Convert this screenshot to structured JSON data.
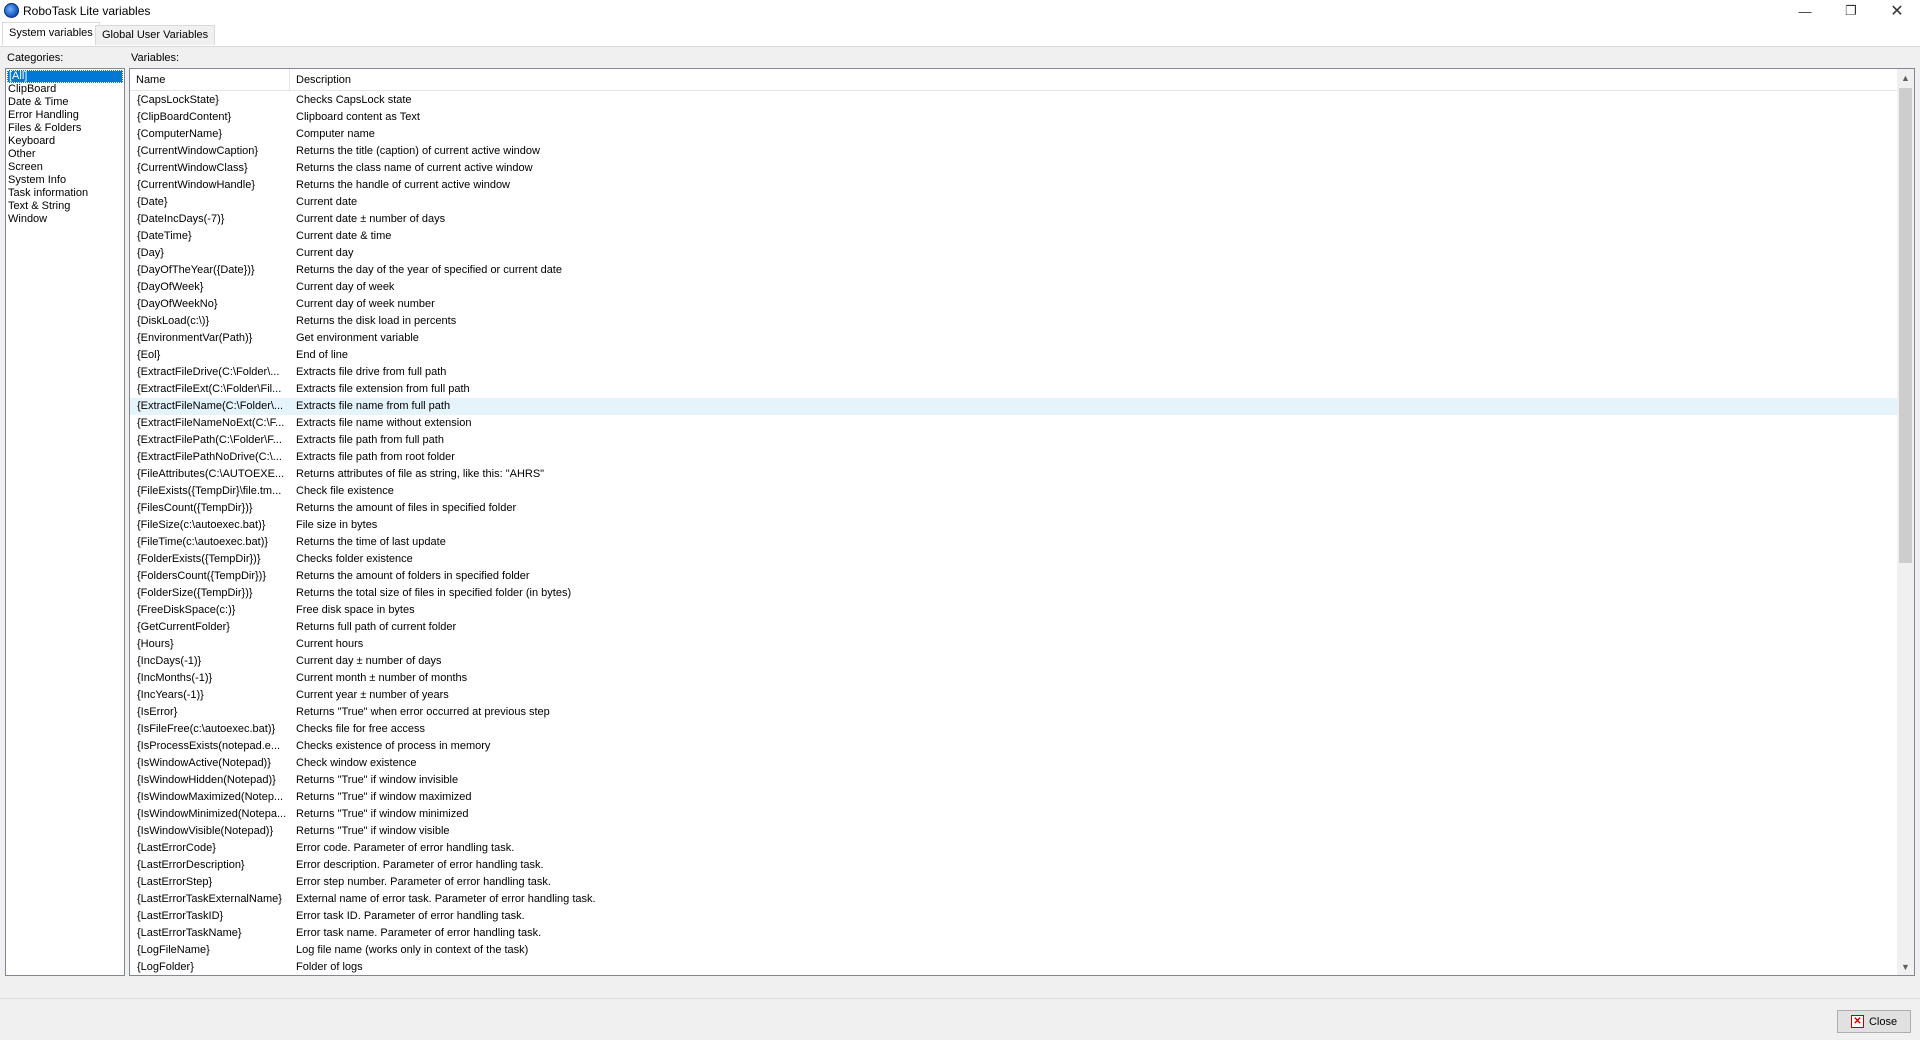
{
  "window": {
    "title": "RoboTask Lite variables",
    "minimize_glyph": "—",
    "maximize_glyph": "❐",
    "close_glyph": "✕"
  },
  "tabs": [
    {
      "label": "System variables",
      "active": true
    },
    {
      "label": "Global User Variables",
      "active": false
    }
  ],
  "categories_label": "Categories:",
  "variables_label": "Variables:",
  "categories": [
    "[All]",
    "ClipBoard",
    "Date & Time",
    "Error Handling",
    "Files & Folders",
    "Keyboard",
    "Other",
    "Screen",
    "System Info",
    "Task information",
    "Text & String",
    "Window"
  ],
  "selected_category": "[All]",
  "columns": {
    "name": "Name",
    "description": "Description"
  },
  "variables": [
    {
      "name": "{CapsLockState}",
      "desc": "Checks CapsLock state"
    },
    {
      "name": "{ClipBoardContent}",
      "desc": "Clipboard content as Text"
    },
    {
      "name": "{ComputerName}",
      "desc": "Computer name"
    },
    {
      "name": "{CurrentWindowCaption}",
      "desc": "Returns the title (caption) of current active window"
    },
    {
      "name": "{CurrentWindowClass}",
      "desc": "Returns the class name of current active window"
    },
    {
      "name": "{CurrentWindowHandle}",
      "desc": "Returns the handle of current active window"
    },
    {
      "name": "{Date}",
      "desc": "Current date"
    },
    {
      "name": "{DateIncDays(-7)}",
      "desc": "Current date ± number of days"
    },
    {
      "name": "{DateTime}",
      "desc": "Current date & time"
    },
    {
      "name": "{Day}",
      "desc": "Current day"
    },
    {
      "name": "{DayOfTheYear({Date})}",
      "desc": "Returns the day of the year of specified or current date"
    },
    {
      "name": "{DayOfWeek}",
      "desc": "Current day of week"
    },
    {
      "name": "{DayOfWeekNo}",
      "desc": "Current day of week number"
    },
    {
      "name": "{DiskLoad(c:\\)}",
      "desc": "Returns the disk load in percents"
    },
    {
      "name": "{EnvironmentVar(Path)}",
      "desc": "Get environment variable"
    },
    {
      "name": "{Eol}",
      "desc": "End of line"
    },
    {
      "name": "{ExtractFileDrive(C:\\Folder\\...",
      "desc": "Extracts file drive from full path"
    },
    {
      "name": "{ExtractFileExt(C:\\Folder\\Fil...",
      "desc": "Extracts file extension from full path"
    },
    {
      "name": "{ExtractFileName(C:\\Folder\\...",
      "desc": "Extracts file name from full path",
      "highlight": true
    },
    {
      "name": "{ExtractFileNameNoExt(C:\\F...",
      "desc": "Extracts file name without extension"
    },
    {
      "name": "{ExtractFilePath(C:\\Folder\\F...",
      "desc": "Extracts file path from full path"
    },
    {
      "name": "{ExtractFilePathNoDrive(C:\\...",
      "desc": "Extracts file path from root folder"
    },
    {
      "name": "{FileAttributes(C:\\AUTOEXE...",
      "desc": "Returns attributes of file as string, like this: \"AHRS\""
    },
    {
      "name": "{FileExists({TempDir}\\file.tm...",
      "desc": "Check file existence"
    },
    {
      "name": "{FilesCount({TempDir})}",
      "desc": "Returns the amount of files in specified folder"
    },
    {
      "name": "{FileSize(c:\\autoexec.bat)}",
      "desc": "File size in bytes"
    },
    {
      "name": "{FileTime(c:\\autoexec.bat)}",
      "desc": "Returns the time of last update"
    },
    {
      "name": "{FolderExists({TempDir})}",
      "desc": "Checks folder existence"
    },
    {
      "name": "{FoldersCount({TempDir})}",
      "desc": "Returns the amount of folders in specified folder"
    },
    {
      "name": "{FolderSize({TempDir})}",
      "desc": "Returns the total size of files in specified folder (in bytes)"
    },
    {
      "name": "{FreeDiskSpace(c:)}",
      "desc": "Free disk space in bytes"
    },
    {
      "name": "{GetCurrentFolder}",
      "desc": "Returns full path of current folder"
    },
    {
      "name": "{Hours}",
      "desc": "Current hours"
    },
    {
      "name": "{IncDays(-1)}",
      "desc": "Current day ± number of days"
    },
    {
      "name": "{IncMonths(-1)}",
      "desc": "Current month ± number of months"
    },
    {
      "name": "{IncYears(-1)}",
      "desc": "Current year ± number of years"
    },
    {
      "name": "{IsError}",
      "desc": "Returns \"True\" when error occurred at previous step"
    },
    {
      "name": "{IsFileFree(c:\\autoexec.bat)}",
      "desc": "Checks file for free access"
    },
    {
      "name": "{IsProcessExists(notepad.e...",
      "desc": "Checks existence of process in memory"
    },
    {
      "name": "{IsWindowActive(Notepad)}",
      "desc": "Check window existence"
    },
    {
      "name": "{IsWindowHidden(Notepad)}",
      "desc": "Returns \"True\" if window invisible"
    },
    {
      "name": "{IsWindowMaximized(Notep...",
      "desc": "Returns \"True\" if window maximized"
    },
    {
      "name": "{IsWindowMinimized(Notepa...",
      "desc": "Returns \"True\" if window minimized"
    },
    {
      "name": "{IsWindowVisible(Notepad)}",
      "desc": "Returns \"True\" if window visible"
    },
    {
      "name": "{LastErrorCode}",
      "desc": "Error code. Parameter of error handling task."
    },
    {
      "name": "{LastErrorDescription}",
      "desc": "Error description. Parameter of error handling task."
    },
    {
      "name": "{LastErrorStep}",
      "desc": "Error step number. Parameter of error handling task."
    },
    {
      "name": "{LastErrorTaskExternalName}",
      "desc": "External name of error task. Parameter of error handling task."
    },
    {
      "name": "{LastErrorTaskID}",
      "desc": "Error task ID. Parameter of error handling task."
    },
    {
      "name": "{LastErrorTaskName}",
      "desc": "Error task name. Parameter of error handling task."
    },
    {
      "name": "{LogFileName}",
      "desc": "Log file name (works only in context of the task)"
    },
    {
      "name": "{LogFolder}",
      "desc": "Folder of logs"
    }
  ],
  "scrollbar": {
    "up_glyph": "▲",
    "down_glyph": "▼"
  },
  "footer": {
    "close_label": "Close",
    "close_icon_glyph": "✕"
  }
}
